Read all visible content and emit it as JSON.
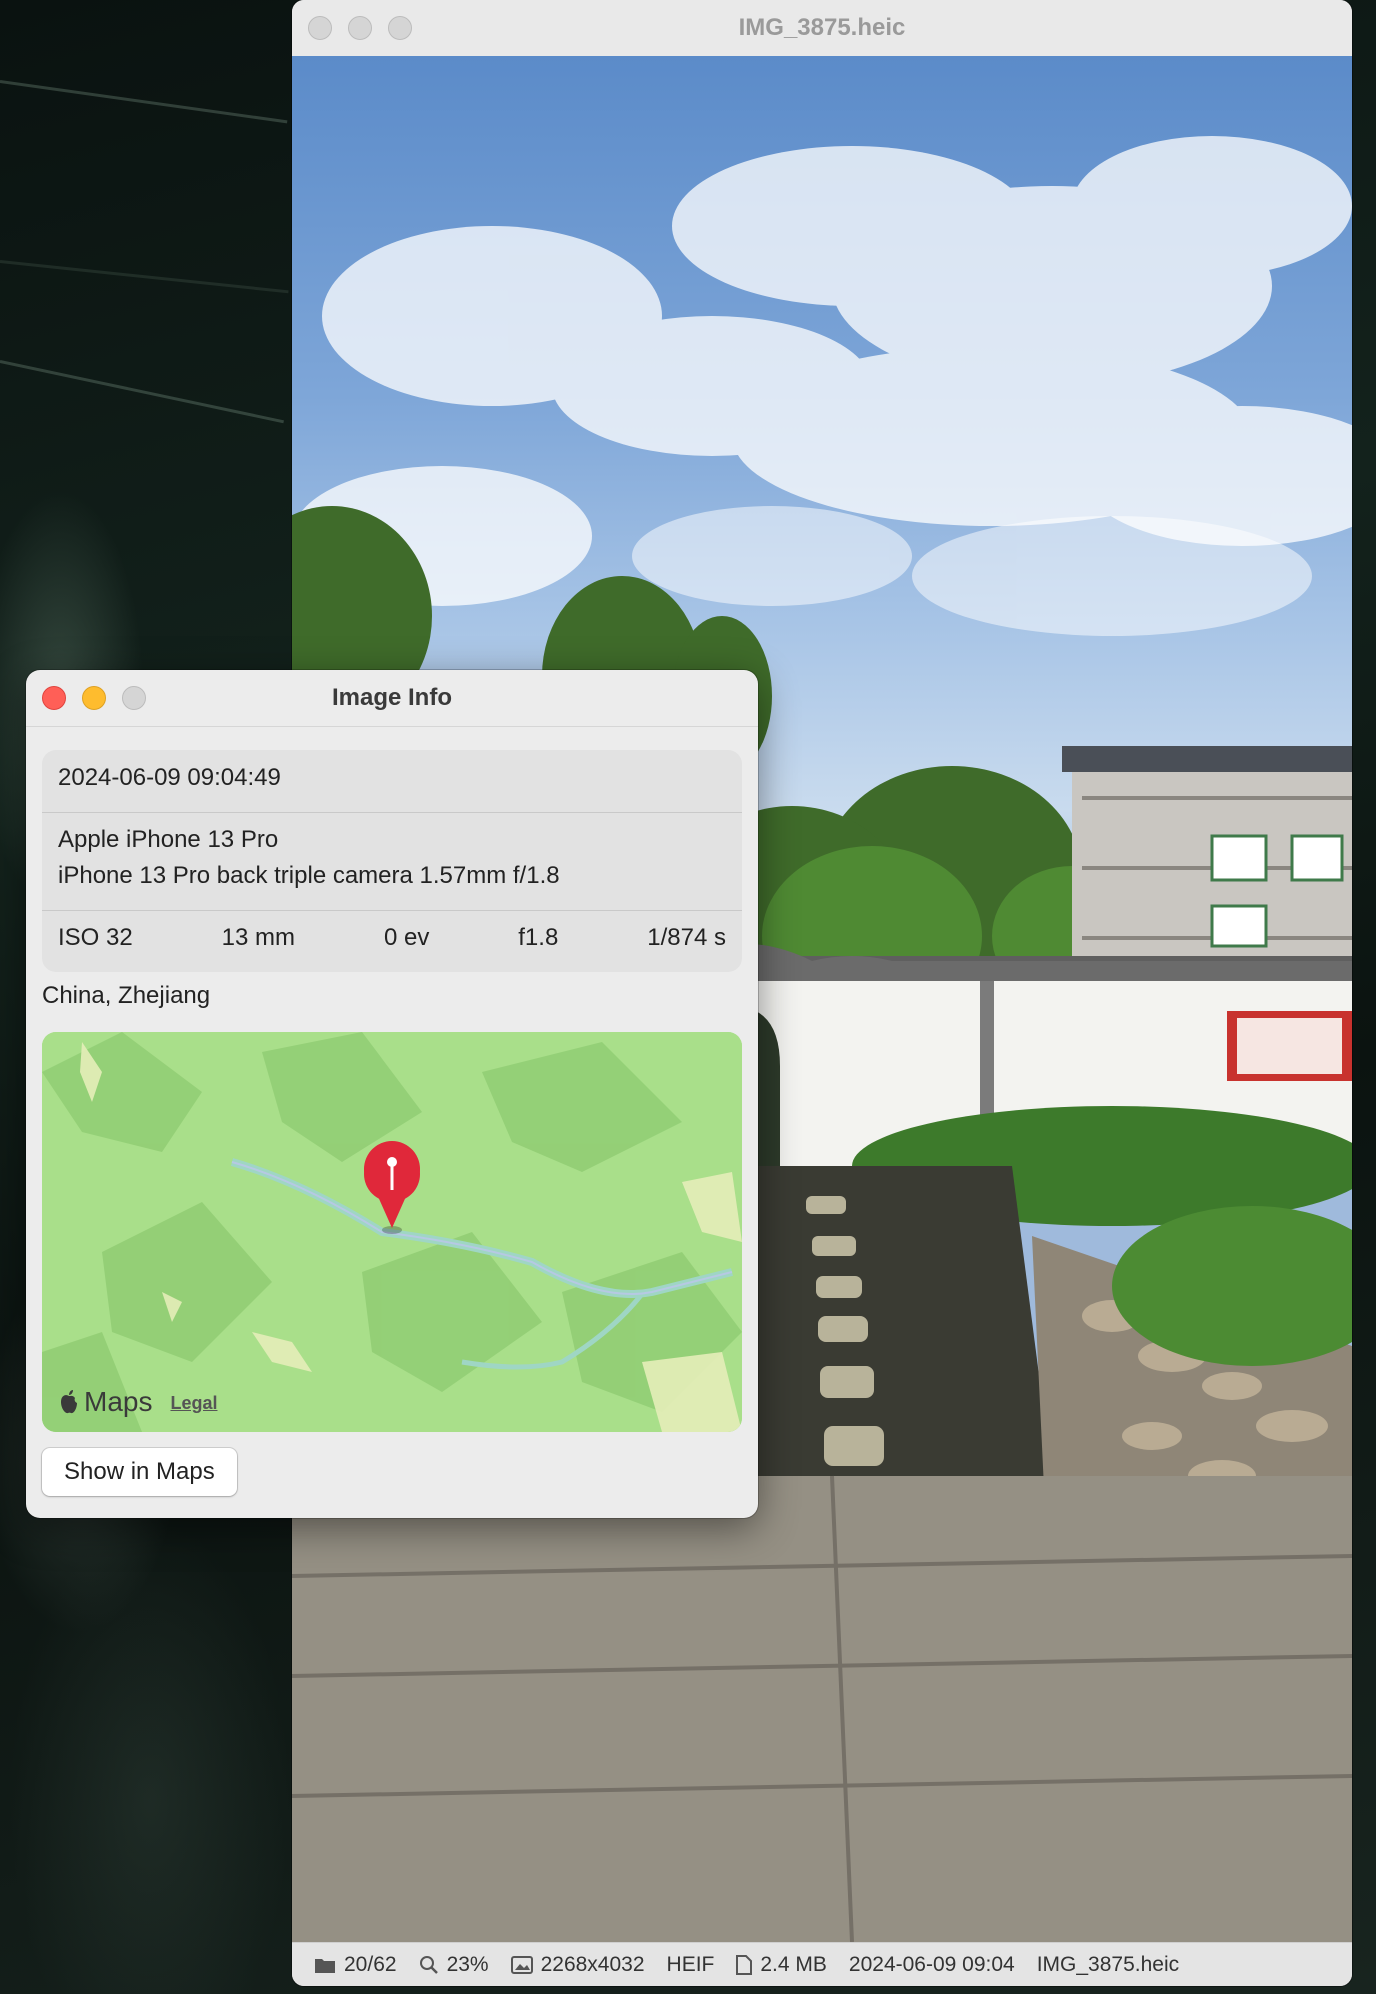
{
  "preview_window": {
    "title": "IMG_3875.heic",
    "statusbar": {
      "page": "20/62",
      "zoom": "23%",
      "dimensions": "2268x4032",
      "format": "HEIF",
      "file_size": "2.4 MB",
      "date": "2024-06-09 09:04",
      "filename": "IMG_3875.heic"
    }
  },
  "info_panel": {
    "title": "Image Info",
    "datetime": "2024-06-09 09:04:49",
    "device": "Apple iPhone 13 Pro",
    "lens": "iPhone 13 Pro back triple camera 1.57mm f/1.8",
    "exif": {
      "iso": "ISO 32",
      "focal_length": "13 mm",
      "exposure_bias": "0 ev",
      "aperture": "f1.8",
      "shutter": "1/874 s"
    },
    "location": "China, Zhejiang",
    "map": {
      "brand": "Maps",
      "legal": "Legal"
    },
    "show_in_maps": "Show in Maps"
  },
  "colors": {
    "close": "#ff5f57",
    "minimize": "#febc2e",
    "zoom_disabled": "#d5d5d5",
    "map_green": "#a9df8a",
    "pin_red": "#e0283a"
  }
}
